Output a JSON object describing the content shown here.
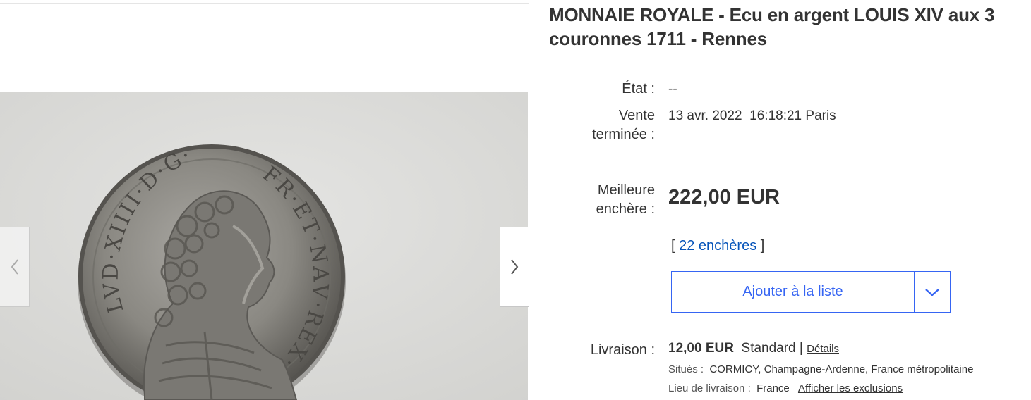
{
  "listing": {
    "title": "MONNAIE ROYALE - Ecu en argent LOUIS XIV aux 3 couronnes 1711 - Rennes"
  },
  "gallery": {
    "image_alt": "Coin photo - Louis XIV portrait",
    "coin_legend_left": "LVD·XIIII·D·G·",
    "coin_legend_right": "FR·ET·NAV·REX·",
    "prev_icon": "chevron-left-icon",
    "next_icon": "chevron-right-icon"
  },
  "condition": {
    "label": "État :",
    "value": "--"
  },
  "ended": {
    "label_line1": "Vente",
    "label_line2": "terminée :",
    "date": "13 avr. 2022",
    "time": "16:18:21 Paris"
  },
  "bid": {
    "label_line1": "Meilleure",
    "label_line2": "enchère :",
    "price": "222,00 EUR",
    "bracket_open": "[",
    "bids_link": "22 enchères",
    "bracket_close": "]"
  },
  "watchlist": {
    "button_label": "Ajouter à la liste",
    "dropdown_icon": "chevron-down-icon"
  },
  "shipping": {
    "label": "Livraison :",
    "price": "12,00 EUR",
    "method": "Standard",
    "separator": "|",
    "details_link": "Détails",
    "location_label": "Situés :",
    "location_value": "CORMICY, Champagne-Ardenne, France métropolitaine",
    "ship_to_label": "Lieu de livraison :",
    "ship_to_value": "France",
    "exclusions_link": "Afficher les exclusions"
  },
  "colors": {
    "accent_blue": "#3665f3",
    "link_blue": "#0654ba",
    "text": "#333333",
    "divider": "#dddddd"
  }
}
